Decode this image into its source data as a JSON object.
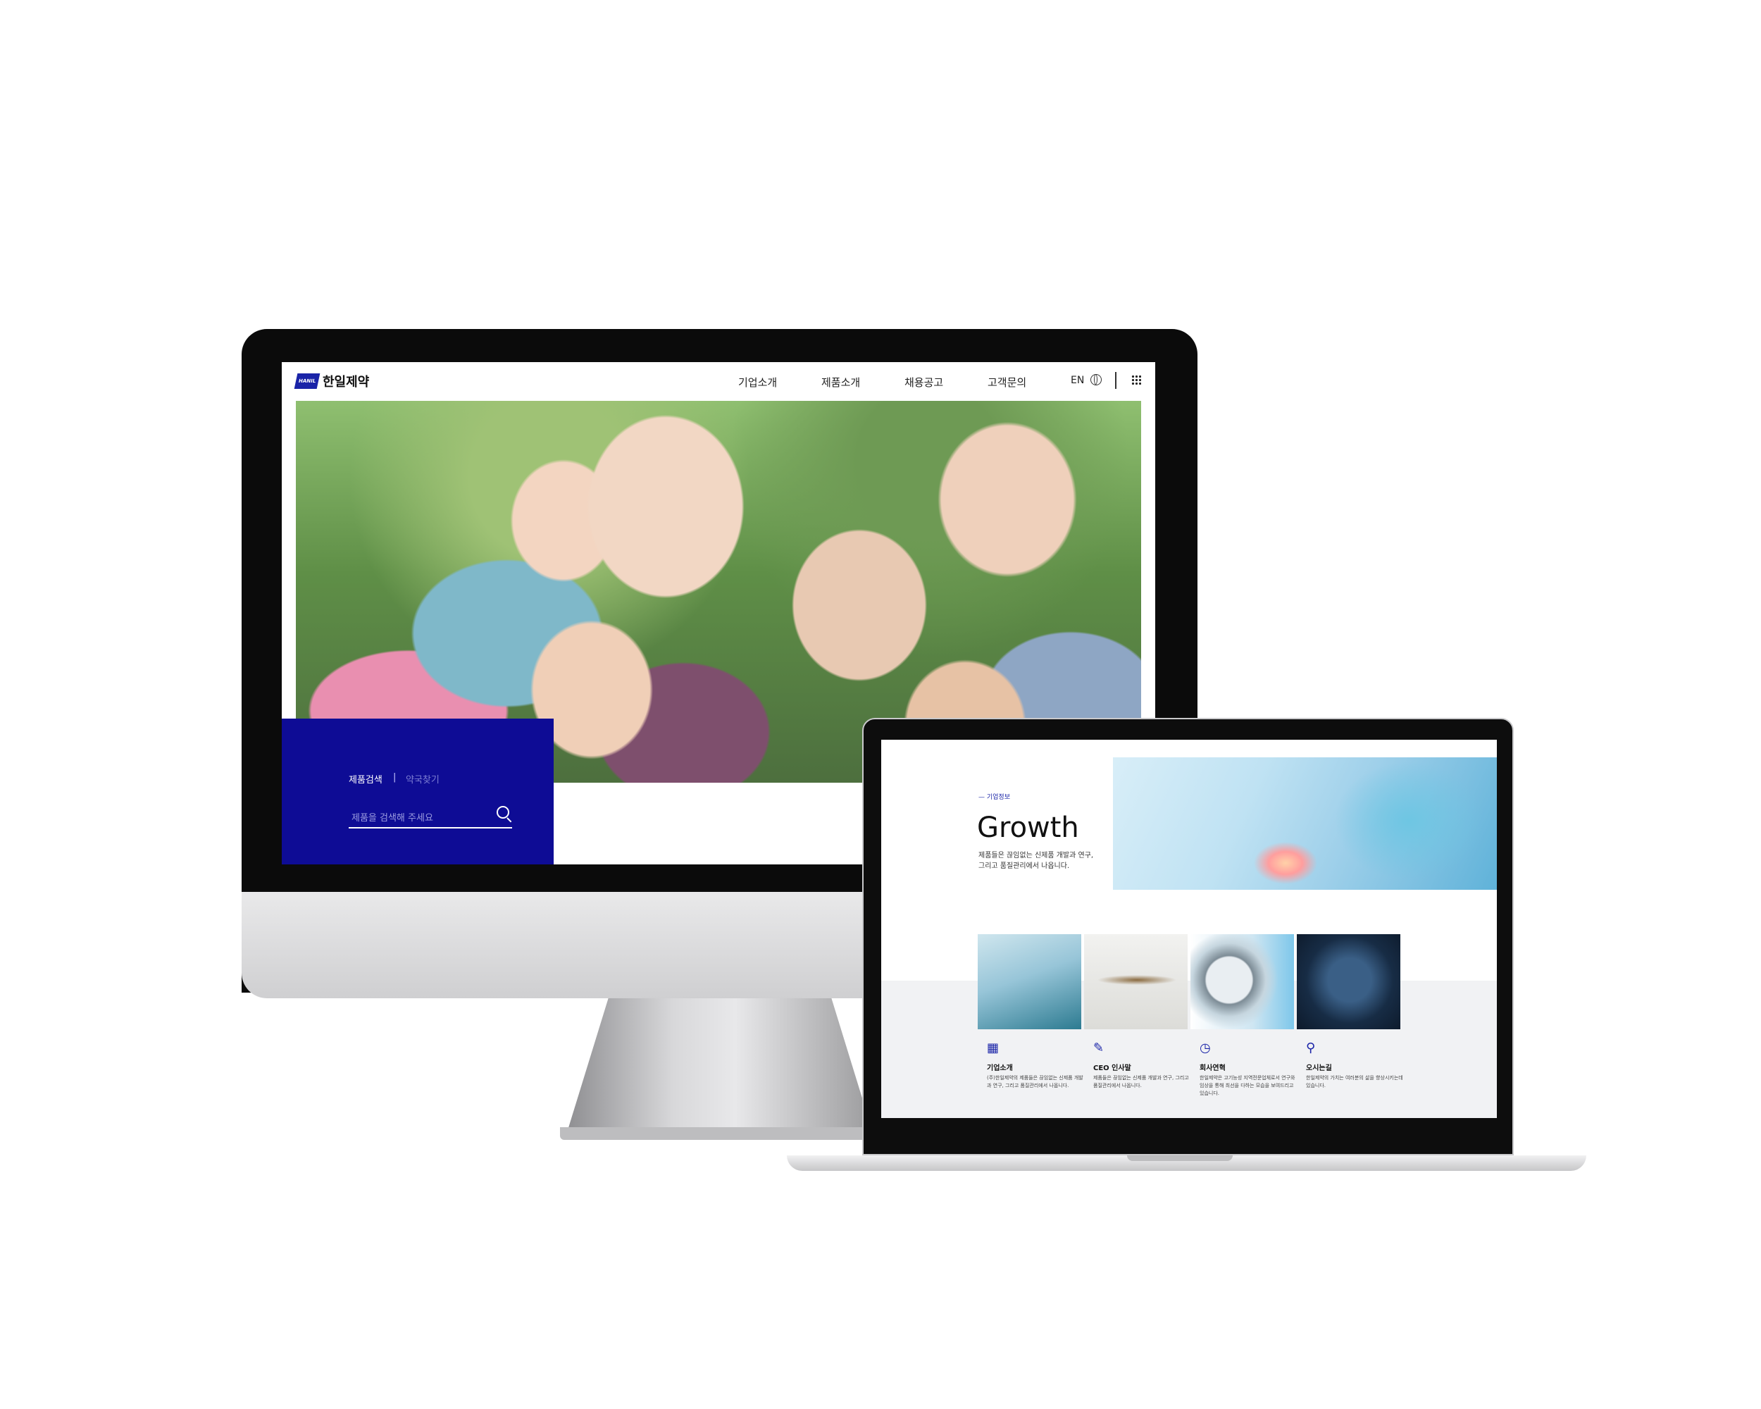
{
  "desktop": {
    "logo": {
      "mark": "HANIL",
      "text": "한일제약",
      "accent": "#1a24a8"
    },
    "nav": [
      "기업소개",
      "제품소개",
      "채용공고",
      "고객문의"
    ],
    "lang": "EN",
    "search": {
      "tabs": [
        "제품검색",
        "약국찾기"
      ],
      "separator": "|",
      "placeholder": "제품을 검색해 주세요",
      "panel_color": "#0e0c95"
    }
  },
  "laptop": {
    "kicker": "— 기업정보",
    "title": "Growth",
    "description": "제품들은 끊임없는 신제품 개발과 연구, 그리고 품질관리에서 나옵니다.",
    "cards": [
      {
        "icon": "building-icon",
        "title": "기업소개",
        "text": "(주)한일제약의 제품들은 끊임없는 신제품 개발과 연구, 그리고 품질관리에서 나옵니다."
      },
      {
        "icon": "pen-icon",
        "title": "CEO 인사말",
        "text": "제품들은 끊임없는 신제품 개발과 연구, 그리고 품질관리에서 나옵니다."
      },
      {
        "icon": "history-icon",
        "title": "회사연혁",
        "text": "한일제약은 고기능성 지역전문업체로서 연구와 임상을 통해 최선을 다하는 모습을 보여드리고 있습니다."
      },
      {
        "icon": "location-pin-icon",
        "title": "오시는길",
        "text": "한일제약의 가치는 여러분의 삶을 향상시키는데 있습니다."
      }
    ]
  }
}
